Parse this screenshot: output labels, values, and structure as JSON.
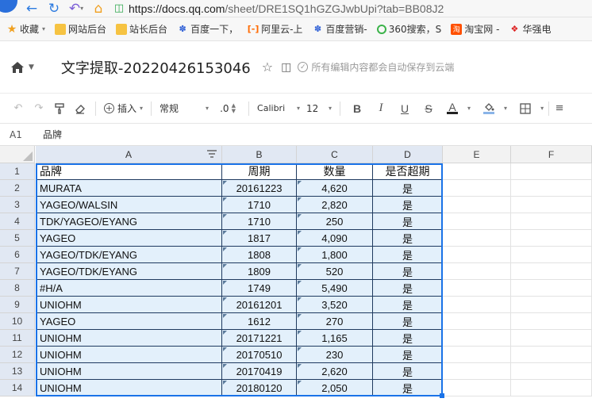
{
  "browser": {
    "url_host": "https://docs.qq.com",
    "url_path": "/sheet/DRE1SQ1hGZGJwbUpi?tab=BB08J2"
  },
  "bookmarks": [
    {
      "label": "收藏",
      "icon": "star-icon",
      "dropdown": true
    },
    {
      "label": "网站后台",
      "icon": "folder-icon"
    },
    {
      "label": "站长后台",
      "icon": "folder-icon"
    },
    {
      "label": "百度一下，",
      "icon": "baidu-paw-icon"
    },
    {
      "label": "阿里云-上",
      "icon": "aliyun-icon"
    },
    {
      "label": "百度营销-",
      "icon": "baidu-paw-icon"
    },
    {
      "label": "360搜索，S",
      "icon": "360-icon"
    },
    {
      "label": "淘宝网 -",
      "icon": "taobao-icon"
    },
    {
      "label": "华强电",
      "icon": "huaqiang-icon"
    }
  ],
  "doc": {
    "title": "文字提取-20220426153046",
    "autosave": "所有编辑内容都会自动保存到云端"
  },
  "toolbar": {
    "insert_label": "插入",
    "format_label": "常规",
    "decimal_label": ".0",
    "font_label": "Calibri",
    "size_label": "12",
    "colors": {
      "font": "#222222",
      "fill": "#8ab4e8"
    }
  },
  "formula": {
    "ref": "A1",
    "value": "品牌"
  },
  "grid": {
    "columns": [
      "A",
      "B",
      "C",
      "D",
      "E",
      "F"
    ],
    "headers": [
      "品牌",
      "周期",
      "数量",
      "是否超期"
    ],
    "rows": [
      [
        "MURATA",
        "20161223",
        "4,620",
        "是"
      ],
      [
        "YAGEO/WALSIN",
        "1710",
        "2,820",
        "是"
      ],
      [
        "TDK/YAGEO/EYANG",
        "1710",
        "250",
        "是"
      ],
      [
        "YAGEO",
        "1817",
        "4,090",
        "是"
      ],
      [
        "YAGEO/TDK/EYANG",
        "1808",
        "1,800",
        "是"
      ],
      [
        "YAGEO/TDK/EYANG",
        "1809",
        "520",
        "是"
      ],
      [
        "#H/A",
        "1749",
        "5,490",
        "是"
      ],
      [
        "UNIOHM",
        "20161201",
        "3,520",
        "是"
      ],
      [
        "YAGEO",
        "1612",
        "270",
        "是"
      ],
      [
        "UNIOHM",
        "20171221",
        "1,165",
        "是"
      ],
      [
        "UNIOHM",
        "20170510",
        "230",
        "是"
      ],
      [
        "UNIOHM",
        "20170419",
        "2,620",
        "是"
      ],
      [
        "UNIOHM",
        "20180120",
        "2,050",
        "是"
      ]
    ],
    "row_numbers": [
      "1",
      "2",
      "3",
      "4",
      "5",
      "6",
      "7",
      "8",
      "9",
      "10",
      "11",
      "12",
      "13",
      "14"
    ]
  }
}
